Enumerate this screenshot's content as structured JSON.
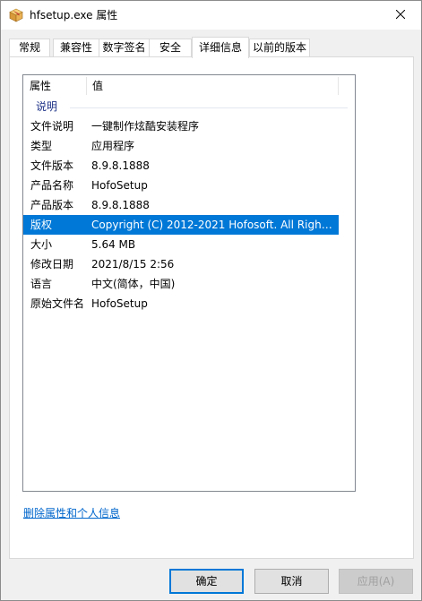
{
  "window": {
    "title": "hfsetup.exe 属性"
  },
  "tabs": [
    {
      "label": "常规",
      "active": false
    },
    {
      "label": "兼容性",
      "active": false
    },
    {
      "label": "数字签名",
      "active": false
    },
    {
      "label": "安全",
      "active": false
    },
    {
      "label": "详细信息",
      "active": true
    },
    {
      "label": "以前的版本",
      "active": false
    }
  ],
  "details": {
    "columns": {
      "name": "属性",
      "value": "值"
    },
    "group_label": "说明",
    "rows": [
      {
        "name": "文件说明",
        "value": "一键制作炫酷安装程序",
        "selected": false
      },
      {
        "name": "类型",
        "value": "应用程序",
        "selected": false
      },
      {
        "name": "文件版本",
        "value": "8.9.8.1888",
        "selected": false
      },
      {
        "name": "产品名称",
        "value": "HofoSetup",
        "selected": false
      },
      {
        "name": "产品版本",
        "value": "8.9.8.1888",
        "selected": false
      },
      {
        "name": "版权",
        "value": "Copyright (C) 2012-2021 Hofosoft. All Rights...",
        "selected": true
      },
      {
        "name": "大小",
        "value": "5.64 MB",
        "selected": false
      },
      {
        "name": "修改日期",
        "value": "2021/8/15 2:56",
        "selected": false
      },
      {
        "name": "语言",
        "value": "中文(简体，中国)",
        "selected": false
      },
      {
        "name": "原始文件名",
        "value": "HofoSetup",
        "selected": false
      }
    ]
  },
  "remove_link": "删除属性和个人信息",
  "buttons": {
    "ok": "确定",
    "cancel": "取消",
    "apply": "应用(A)"
  },
  "colors": {
    "selection": "#0078d7",
    "link": "#0066cc",
    "group_header": "#1e3287"
  },
  "icons": {
    "app": "package-icon",
    "close": "close-icon"
  }
}
